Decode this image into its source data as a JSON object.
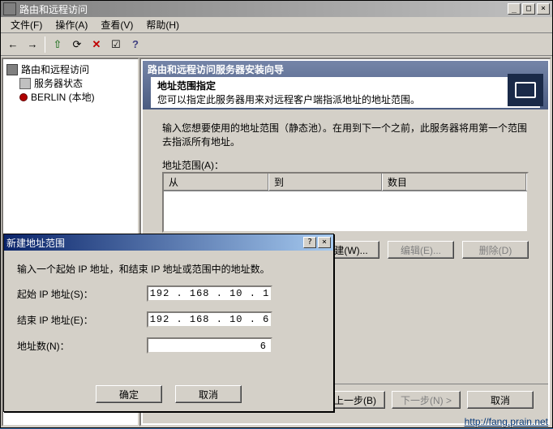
{
  "main_window": {
    "title": "路由和远程访问",
    "controls": {
      "min": "_",
      "max": "□",
      "close": "×"
    }
  },
  "menu": {
    "file": "文件(F)",
    "action": "操作(A)",
    "view": "查看(V)",
    "help": "帮助(H)"
  },
  "toolbar": {
    "back": "←",
    "forward": "→",
    "up": "⇧",
    "refresh": "⟳",
    "delete": "✕",
    "props": "☑",
    "help": "?"
  },
  "tree": {
    "root": "路由和远程访问",
    "server_status": "服务器状态",
    "server": "BERLIN (本地)"
  },
  "wizard": {
    "banner_title": "路由和远程访问服务器安装向导",
    "heading": "地址范围指定",
    "subheading": "您可以指定此服务器用来对远程客户端指派地址的地址范围。",
    "body_text": "输入您想要使用的地址范围（静态池）。在用到下一个之前，此服务器将用第一个范围去指派所有地址。",
    "list_label": "地址范围(A)：",
    "cols": {
      "from": "从",
      "to": "到",
      "count": "数目"
    },
    "btns": {
      "new": "新建(W)...",
      "edit": "编辑(E)...",
      "del": "删除(D)"
    },
    "nav": {
      "back": "< 上一步(B)",
      "next": "下一步(N) >",
      "cancel": "取消"
    }
  },
  "dialog": {
    "title": "新建地址范围",
    "controls": {
      "help": "?",
      "close": "×"
    },
    "instruction": "输入一个起始 IP 地址，和结束 IP 地址或范围中的地址数。",
    "labels": {
      "start": "起始 IP 地址(S)：",
      "end": "结束 IP 地址(E)：",
      "count": "地址数(N)："
    },
    "values": {
      "start": "192 . 168 . 10 .  1",
      "end": "192 . 168 . 10 .  6",
      "count": "6"
    },
    "btns": {
      "ok": "确定",
      "cancel": "取消"
    }
  },
  "watermark": "http://fang.prain.net"
}
